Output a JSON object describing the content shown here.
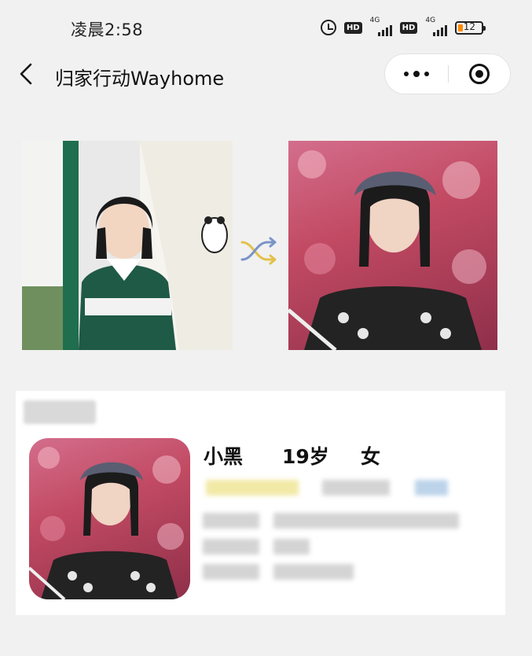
{
  "status_bar": {
    "time": "凌晨2:58",
    "signal_1": "4G",
    "signal_2": "4G",
    "hd_label": "HD",
    "battery": "12",
    "battery_color": "#ff8a00"
  },
  "nav": {
    "title": "归家行动Wayhome",
    "back_icon": "chevron-left-icon",
    "more_icon": "more-dots-icon",
    "close_icon": "target-icon"
  },
  "comparison": {
    "swap_icon": "shuffle-icon",
    "arrow_colors": [
      "#e3c14a",
      "#7a95c7"
    ]
  },
  "person": {
    "name": "小黑",
    "age": "19岁",
    "gender": "女"
  },
  "colors": {
    "background": "#f1f1f1",
    "card": "#ffffff"
  }
}
